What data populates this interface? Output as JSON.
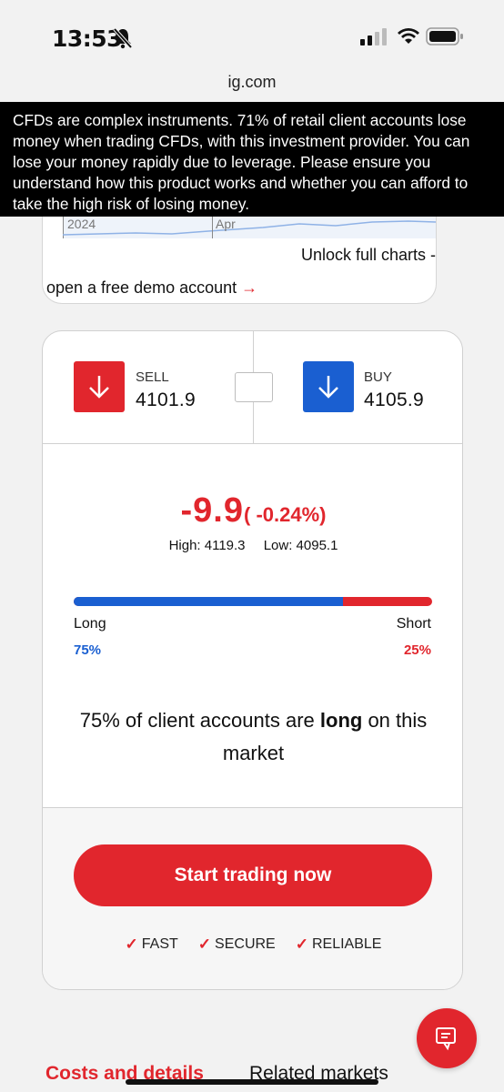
{
  "status_bar": {
    "time": "13:53"
  },
  "browser": {
    "url": "ig.com"
  },
  "risk_warning": "CFDs are complex instruments. 71% of retail client accounts lose money when trading CFDs, with this investment provider. You can lose your money rapidly due to leverage. Please ensure you understand how this product works and whether you can afford to take the high risk of losing money.",
  "chart_preview": {
    "tick_labels": [
      "2024",
      "Apr"
    ],
    "unlock_text": "Unlock full charts -",
    "demo_link_text": "open a free demo account"
  },
  "prices": {
    "sell_label": "SELL",
    "sell_value": "4101.9",
    "buy_label": "BUY",
    "buy_value": "4105.9"
  },
  "change": {
    "value": "-9.9",
    "percent": "( -0.24%)",
    "high_label": "High: 4119.3",
    "low_label": "Low: 4095.1"
  },
  "sentiment": {
    "long_label": "Long",
    "short_label": "Short",
    "long_pct": "75%",
    "short_pct": "25%",
    "long_fraction": 0.75,
    "text_prefix": "75% of client accounts are ",
    "text_bold": "long",
    "text_suffix": " on this market"
  },
  "cta": {
    "button_label": "Start trading now",
    "features": [
      "FAST",
      "SECURE",
      "RELIABLE"
    ]
  },
  "tabs": {
    "costs": "Costs and details",
    "related": "Related markets"
  },
  "colors": {
    "sell": "#e1262d",
    "buy": "#1a5fd1"
  }
}
